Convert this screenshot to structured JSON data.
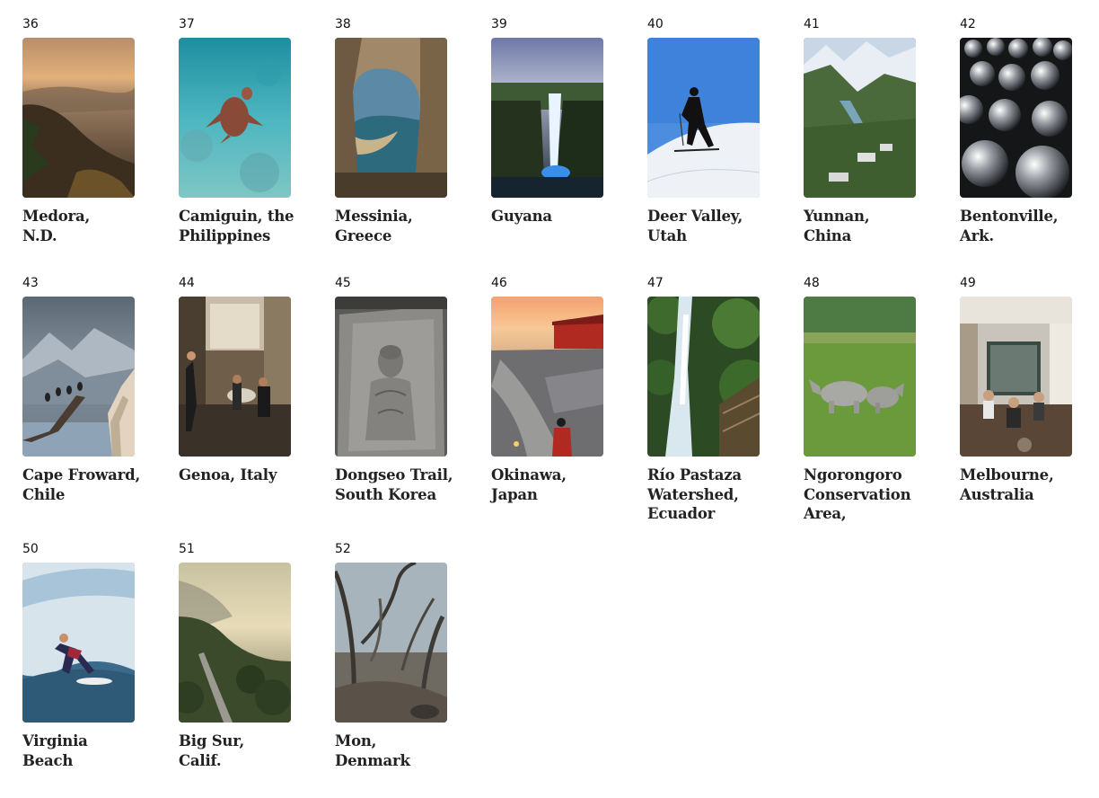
{
  "items": [
    {
      "number": "36",
      "name": [
        "Medora,",
        "N.D."
      ],
      "icon": "medora-landscape-image"
    },
    {
      "number": "37",
      "name": [
        "Camiguin, the",
        "Philippines"
      ],
      "icon": "sea-turtle-image"
    },
    {
      "number": "38",
      "name": [
        "Messinia,",
        "Greece"
      ],
      "icon": "stone-arch-bay-image"
    },
    {
      "number": "39",
      "name": [
        "Guyana"
      ],
      "icon": "waterfall-image"
    },
    {
      "number": "40",
      "name": [
        "Deer Valley,",
        "Utah"
      ],
      "icon": "skier-image"
    },
    {
      "number": "41",
      "name": [
        "Yunnan,",
        "China"
      ],
      "icon": "mountain-valley-image"
    },
    {
      "number": "42",
      "name": [
        "Bentonville,",
        "Ark."
      ],
      "icon": "silver-spheres-image"
    },
    {
      "number": "43",
      "name": [
        "Cape Froward,",
        "Chile"
      ],
      "icon": "birds-on-branch-image"
    },
    {
      "number": "44",
      "name": [
        "Genoa, Italy"
      ],
      "icon": "street-cafe-image"
    },
    {
      "number": "45",
      "name": [
        "Dongseo Trail,",
        "South Korea"
      ],
      "icon": "buddha-carving-image"
    },
    {
      "number": "46",
      "name": [
        "Okinawa,",
        "Japan"
      ],
      "icon": "castle-walls-image"
    },
    {
      "number": "47",
      "name": [
        "Río Pastaza",
        "Watershed,",
        "Ecuador"
      ],
      "icon": "jungle-waterfall-image"
    },
    {
      "number": "48",
      "name": [
        "Ngorongoro",
        "Conservation",
        "Area,"
      ],
      "icon": "rhino-grassland-image"
    },
    {
      "number": "49",
      "name": [
        "Melbourne,",
        "Australia"
      ],
      "icon": "restaurant-interior-image"
    },
    {
      "number": "50",
      "name": [
        "Virginia",
        "Beach"
      ],
      "icon": "surfer-wave-image"
    },
    {
      "number": "51",
      "name": [
        "Big Sur,",
        "Calif."
      ],
      "icon": "coastal-road-image"
    },
    {
      "number": "52",
      "name": [
        "Mon,",
        "Denmark"
      ],
      "icon": "misty-forest-image"
    }
  ]
}
